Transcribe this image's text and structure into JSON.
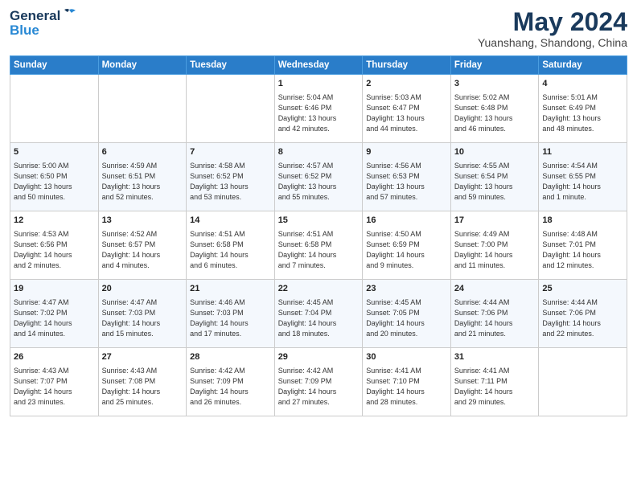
{
  "header": {
    "logo_general": "General",
    "logo_blue": "Blue",
    "title": "May 2024",
    "subtitle": "Yuanshang, Shandong, China"
  },
  "days_of_week": [
    "Sunday",
    "Monday",
    "Tuesday",
    "Wednesday",
    "Thursday",
    "Friday",
    "Saturday"
  ],
  "weeks": [
    {
      "cells": [
        {
          "day": "",
          "info": ""
        },
        {
          "day": "",
          "info": ""
        },
        {
          "day": "",
          "info": ""
        },
        {
          "day": "1",
          "info": "Sunrise: 5:04 AM\nSunset: 6:46 PM\nDaylight: 13 hours\nand 42 minutes."
        },
        {
          "day": "2",
          "info": "Sunrise: 5:03 AM\nSunset: 6:47 PM\nDaylight: 13 hours\nand 44 minutes."
        },
        {
          "day": "3",
          "info": "Sunrise: 5:02 AM\nSunset: 6:48 PM\nDaylight: 13 hours\nand 46 minutes."
        },
        {
          "day": "4",
          "info": "Sunrise: 5:01 AM\nSunset: 6:49 PM\nDaylight: 13 hours\nand 48 minutes."
        }
      ]
    },
    {
      "cells": [
        {
          "day": "5",
          "info": "Sunrise: 5:00 AM\nSunset: 6:50 PM\nDaylight: 13 hours\nand 50 minutes."
        },
        {
          "day": "6",
          "info": "Sunrise: 4:59 AM\nSunset: 6:51 PM\nDaylight: 13 hours\nand 52 minutes."
        },
        {
          "day": "7",
          "info": "Sunrise: 4:58 AM\nSunset: 6:52 PM\nDaylight: 13 hours\nand 53 minutes."
        },
        {
          "day": "8",
          "info": "Sunrise: 4:57 AM\nSunset: 6:52 PM\nDaylight: 13 hours\nand 55 minutes."
        },
        {
          "day": "9",
          "info": "Sunrise: 4:56 AM\nSunset: 6:53 PM\nDaylight: 13 hours\nand 57 minutes."
        },
        {
          "day": "10",
          "info": "Sunrise: 4:55 AM\nSunset: 6:54 PM\nDaylight: 13 hours\nand 59 minutes."
        },
        {
          "day": "11",
          "info": "Sunrise: 4:54 AM\nSunset: 6:55 PM\nDaylight: 14 hours\nand 1 minute."
        }
      ]
    },
    {
      "cells": [
        {
          "day": "12",
          "info": "Sunrise: 4:53 AM\nSunset: 6:56 PM\nDaylight: 14 hours\nand 2 minutes."
        },
        {
          "day": "13",
          "info": "Sunrise: 4:52 AM\nSunset: 6:57 PM\nDaylight: 14 hours\nand 4 minutes."
        },
        {
          "day": "14",
          "info": "Sunrise: 4:51 AM\nSunset: 6:58 PM\nDaylight: 14 hours\nand 6 minutes."
        },
        {
          "day": "15",
          "info": "Sunrise: 4:51 AM\nSunset: 6:58 PM\nDaylight: 14 hours\nand 7 minutes."
        },
        {
          "day": "16",
          "info": "Sunrise: 4:50 AM\nSunset: 6:59 PM\nDaylight: 14 hours\nand 9 minutes."
        },
        {
          "day": "17",
          "info": "Sunrise: 4:49 AM\nSunset: 7:00 PM\nDaylight: 14 hours\nand 11 minutes."
        },
        {
          "day": "18",
          "info": "Sunrise: 4:48 AM\nSunset: 7:01 PM\nDaylight: 14 hours\nand 12 minutes."
        }
      ]
    },
    {
      "cells": [
        {
          "day": "19",
          "info": "Sunrise: 4:47 AM\nSunset: 7:02 PM\nDaylight: 14 hours\nand 14 minutes."
        },
        {
          "day": "20",
          "info": "Sunrise: 4:47 AM\nSunset: 7:03 PM\nDaylight: 14 hours\nand 15 minutes."
        },
        {
          "day": "21",
          "info": "Sunrise: 4:46 AM\nSunset: 7:03 PM\nDaylight: 14 hours\nand 17 minutes."
        },
        {
          "day": "22",
          "info": "Sunrise: 4:45 AM\nSunset: 7:04 PM\nDaylight: 14 hours\nand 18 minutes."
        },
        {
          "day": "23",
          "info": "Sunrise: 4:45 AM\nSunset: 7:05 PM\nDaylight: 14 hours\nand 20 minutes."
        },
        {
          "day": "24",
          "info": "Sunrise: 4:44 AM\nSunset: 7:06 PM\nDaylight: 14 hours\nand 21 minutes."
        },
        {
          "day": "25",
          "info": "Sunrise: 4:44 AM\nSunset: 7:06 PM\nDaylight: 14 hours\nand 22 minutes."
        }
      ]
    },
    {
      "cells": [
        {
          "day": "26",
          "info": "Sunrise: 4:43 AM\nSunset: 7:07 PM\nDaylight: 14 hours\nand 23 minutes."
        },
        {
          "day": "27",
          "info": "Sunrise: 4:43 AM\nSunset: 7:08 PM\nDaylight: 14 hours\nand 25 minutes."
        },
        {
          "day": "28",
          "info": "Sunrise: 4:42 AM\nSunset: 7:09 PM\nDaylight: 14 hours\nand 26 minutes."
        },
        {
          "day": "29",
          "info": "Sunrise: 4:42 AM\nSunset: 7:09 PM\nDaylight: 14 hours\nand 27 minutes."
        },
        {
          "day": "30",
          "info": "Sunrise: 4:41 AM\nSunset: 7:10 PM\nDaylight: 14 hours\nand 28 minutes."
        },
        {
          "day": "31",
          "info": "Sunrise: 4:41 AM\nSunset: 7:11 PM\nDaylight: 14 hours\nand 29 minutes."
        },
        {
          "day": "",
          "info": ""
        }
      ]
    }
  ]
}
